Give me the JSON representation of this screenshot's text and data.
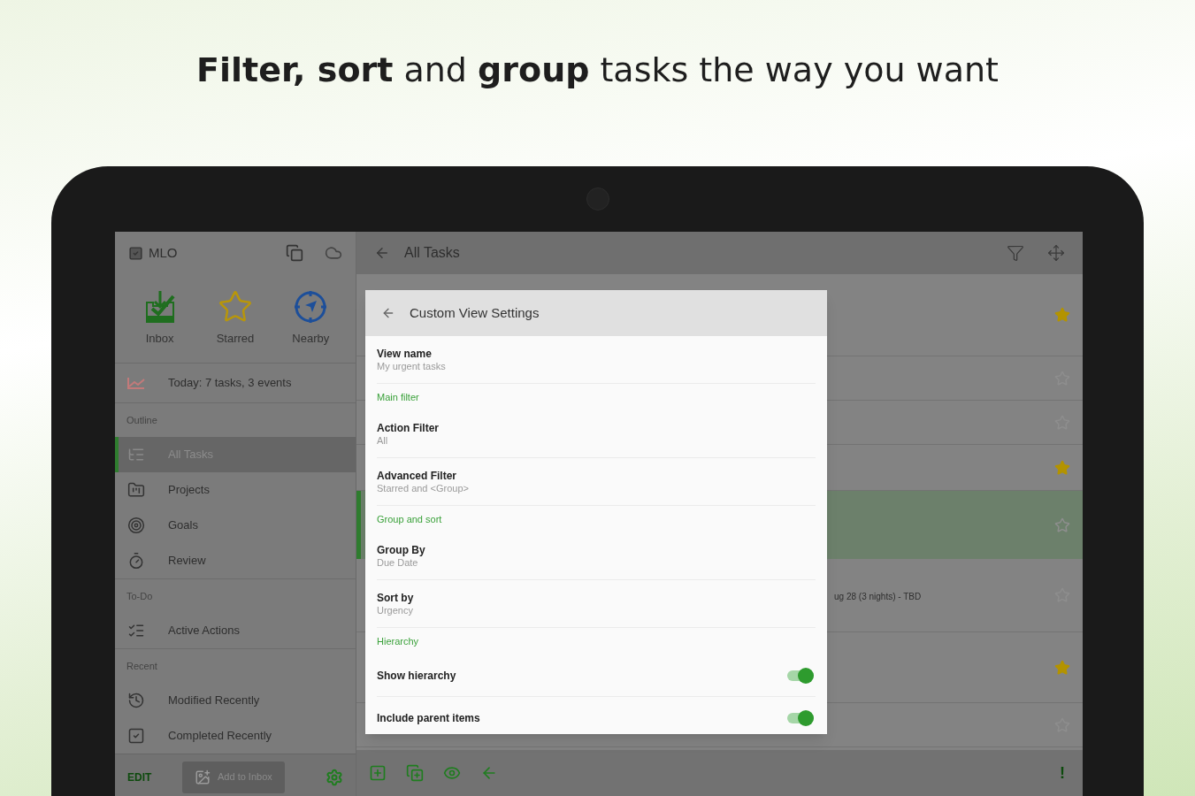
{
  "headline": "**Filter, sort** and **group** tasks the way you want",
  "sidebar": {
    "app_name": "MLO",
    "quick": [
      {
        "kind": "inbox",
        "label": "Inbox"
      },
      {
        "kind": "star",
        "label": "Starred"
      },
      {
        "kind": "nearby",
        "label": "Nearby"
      }
    ],
    "today": "Today: 7 tasks, 3 events",
    "sections": [
      {
        "title": "Outline",
        "items": [
          {
            "kind": "tree",
            "label": "All Tasks",
            "selected": true
          },
          {
            "kind": "projects",
            "label": "Projects",
            "selected": false
          },
          {
            "kind": "goals",
            "label": "Goals",
            "selected": false
          },
          {
            "kind": "review",
            "label": "Review",
            "selected": false
          }
        ]
      },
      {
        "title": "To-Do",
        "items": [
          {
            "kind": "actions",
            "label": "Active Actions",
            "selected": false
          }
        ]
      },
      {
        "title": "Recent",
        "items": [
          {
            "kind": "modified",
            "label": "Modified Recently",
            "selected": false
          },
          {
            "kind": "completed",
            "label": "Completed Recently",
            "selected": false
          }
        ]
      }
    ],
    "edit": "EDIT",
    "add_button": "Add to Inbox"
  },
  "main": {
    "title": "All Tasks",
    "rows": [
      {
        "starred": true,
        "selected": false
      },
      {
        "starred": false,
        "selected": false
      },
      {
        "starred": false,
        "selected": false
      },
      {
        "starred": true,
        "selected": false
      },
      {
        "starred": false,
        "selected": true
      },
      {
        "starred": false,
        "selected": false,
        "text": "ug 28 (3 nights) - TBD"
      },
      {
        "starred": true,
        "selected": false
      },
      {
        "starred": false,
        "selected": false
      }
    ],
    "priority_mark": "!"
  },
  "dialog": {
    "title": "Custom View Settings",
    "items": [
      {
        "kind": "setting",
        "title": "View name",
        "value": "My urgent tasks"
      },
      {
        "kind": "section",
        "title": "Main filter"
      },
      {
        "kind": "setting",
        "title": "Action Filter",
        "value": "All"
      },
      {
        "kind": "setting",
        "title": "Advanced Filter",
        "value": "Starred and <Group>"
      },
      {
        "kind": "section",
        "title": "Group and sort"
      },
      {
        "kind": "setting",
        "title": "Group By",
        "value": "Due Date"
      },
      {
        "kind": "setting",
        "title": "Sort by",
        "value": "Urgency"
      },
      {
        "kind": "section",
        "title": "Hierarchy"
      },
      {
        "kind": "toggle",
        "title": "Show hierarchy",
        "on": true
      },
      {
        "kind": "toggle",
        "title": "Include parent items",
        "on": true
      }
    ]
  }
}
